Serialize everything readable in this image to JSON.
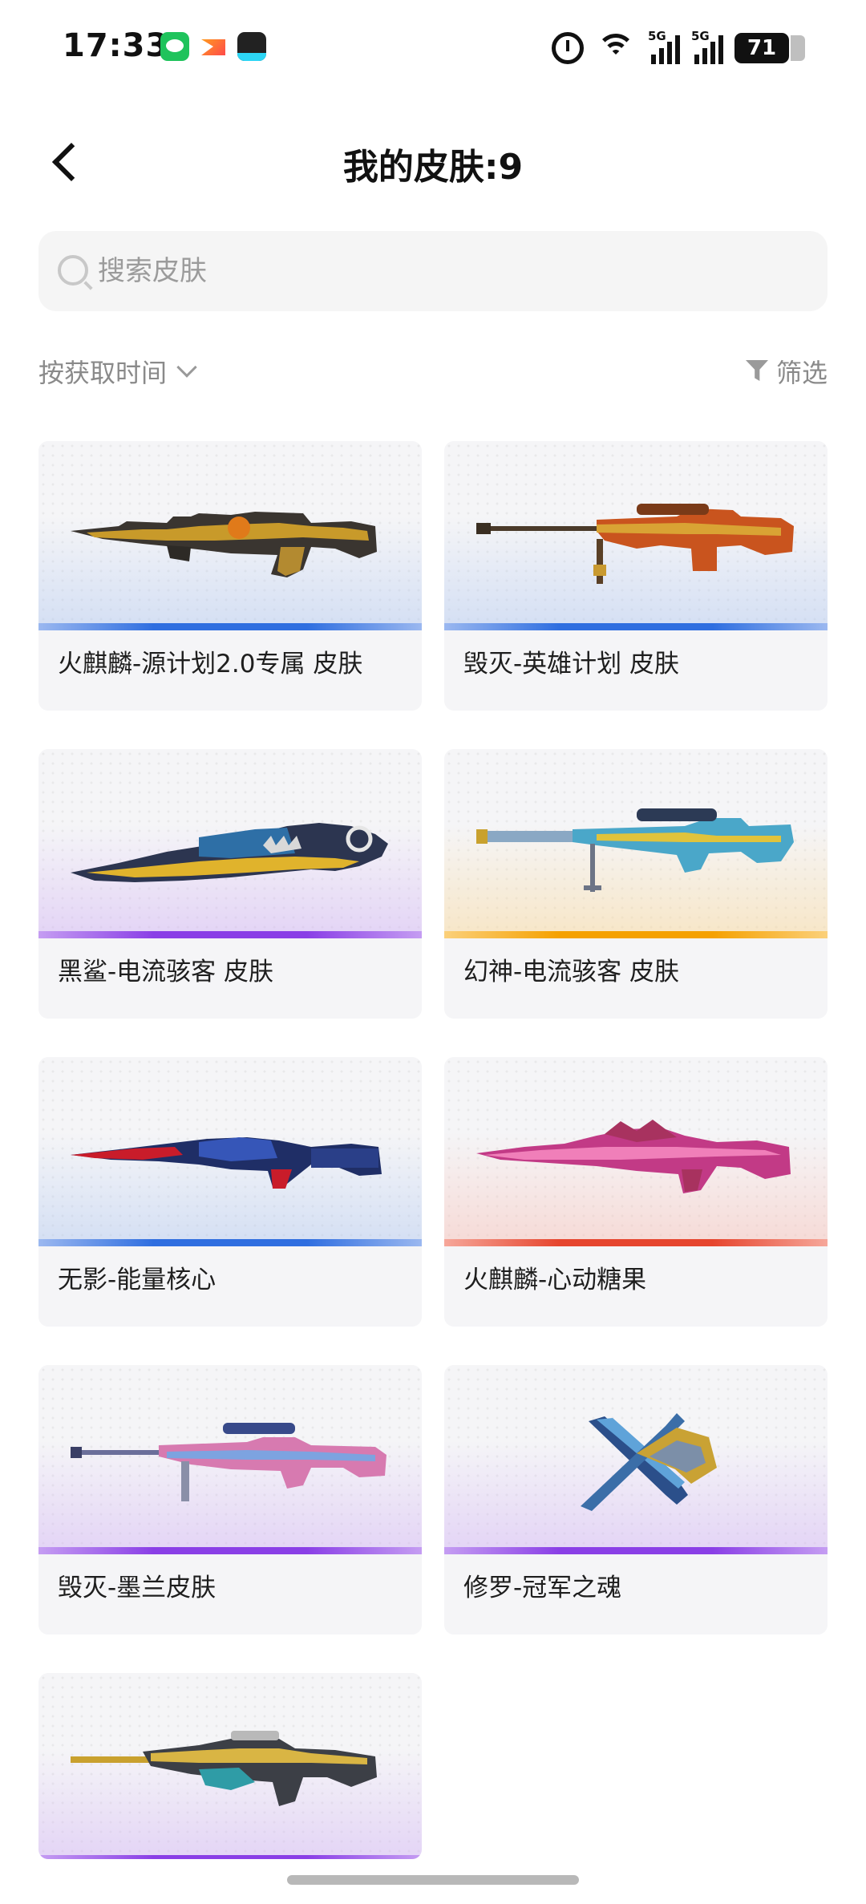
{
  "status_bar": {
    "time": "17:33",
    "notification_icons": [
      "wechat-icon",
      "mail-icon",
      "news-app-icon"
    ],
    "sys_icons": [
      "alarm-icon",
      "wifi-icon",
      "signal-5g-icon",
      "signal-5g-icon"
    ],
    "network_label_1": "5G",
    "network_label_2": "5G",
    "battery": "71"
  },
  "header": {
    "back_icon": "back-arrow-icon",
    "title": "我的皮肤:9"
  },
  "search": {
    "placeholder": "搜索皮肤",
    "value": "",
    "icon": "search-icon"
  },
  "toolbar": {
    "sort_label": "按获取时间",
    "sort_icon": "chevron-down-icon",
    "filter_label": "筛选",
    "filter_icon": "filter-icon"
  },
  "skins": [
    {
      "label": "火麒麟-源计划2.0专属 皮肤",
      "tint": "blue",
      "accent": "#2f6ee0"
    },
    {
      "label": "毁灭-英雄计划 皮肤",
      "tint": "blue",
      "accent": "#2f6ee0"
    },
    {
      "label": "黑鲨-电流骇客 皮肤",
      "tint": "purple",
      "accent": "#8a3fe6"
    },
    {
      "label": "幻神-电流骇客 皮肤",
      "tint": "orange",
      "accent": "#f5a100"
    },
    {
      "label": "无影-能量核心",
      "tint": "blue",
      "accent": "#2f6ee0"
    },
    {
      "label": "火麒麟-心动糖果",
      "tint": "red",
      "accent": "#e6452e"
    },
    {
      "label": "毁灭-墨兰皮肤",
      "tint": "purple",
      "accent": "#8a3fe6"
    },
    {
      "label": "修罗-冠军之魂",
      "tint": "purple",
      "accent": "#8a3fe6"
    },
    {
      "label": "",
      "tint": "purple",
      "accent": "#8a3fe6"
    }
  ]
}
